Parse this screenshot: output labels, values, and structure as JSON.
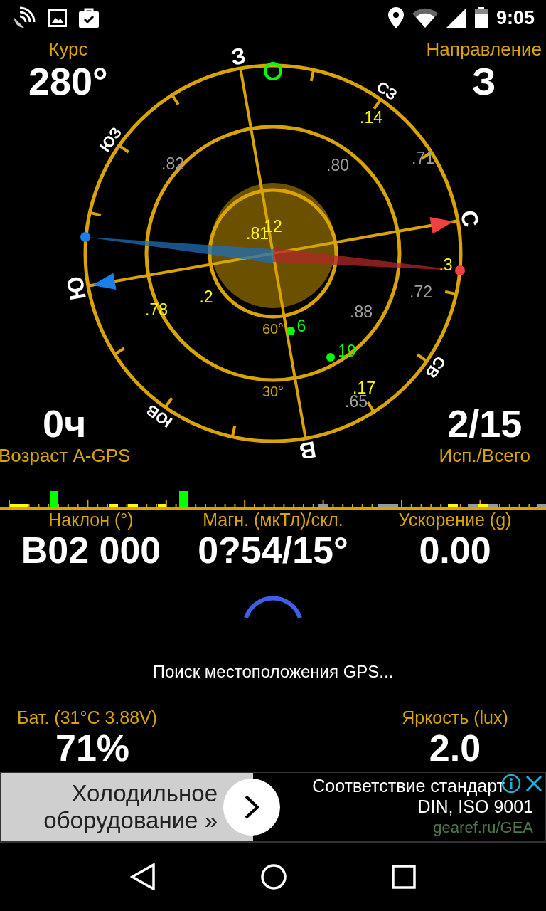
{
  "status_bar": {
    "time": "9:05"
  },
  "compass": {
    "course": {
      "label": "Курс",
      "value": "280°"
    },
    "direction": {
      "label": "Направление",
      "value": "З"
    },
    "agps": {
      "label": "Возраст A-GPS",
      "value": "0ч"
    },
    "used_total": {
      "label": "Исп./Всего",
      "value": "2/15"
    },
    "cardinals": [
      "С",
      "СВ",
      "В",
      "ЮВ",
      "Ю",
      "ЮЗ",
      "З",
      "СЗ"
    ],
    "rings": [
      "60°",
      "30°"
    ],
    "satellites": [
      {
        "label": ".14",
        "color": "#ffff00",
        "used": false
      },
      {
        "label": ".82",
        "color": "#a0a0a0",
        "used": false
      },
      {
        "label": ".80",
        "color": "#a0a0a0",
        "used": false
      },
      {
        "label": ".71",
        "color": "#a0a0a0",
        "used": false
      },
      {
        "label": ".81",
        "color": "#ffff00",
        "used": false
      },
      {
        "label": "12",
        "color": "#ffff00",
        "used": false
      },
      {
        "label": ".3",
        "color": "#ffff00",
        "used": false
      },
      {
        "label": ".72",
        "color": "#a0a0a0",
        "used": false
      },
      {
        "label": ".2",
        "color": "#ffff00",
        "used": false
      },
      {
        "label": ".78",
        "color": "#ffff00",
        "used": false
      },
      {
        "label": ".88",
        "color": "#a0a0a0",
        "used": false
      },
      {
        "label": "6",
        "color": "#00ff00",
        "used": true
      },
      {
        "label": "19",
        "color": "#00ff00",
        "used": true
      },
      {
        "label": ".17",
        "color": "#ffff00",
        "used": false
      },
      {
        "label": ".65",
        "color": "#a0a0a0",
        "used": false
      }
    ]
  },
  "readings": [
    {
      "label": "Наклон (°)",
      "value": "В02 000"
    },
    {
      "label": "Магн. (мкТл)/скл.",
      "value": "0?54/15°"
    },
    {
      "label": "Ускорение (g)",
      "value": "0.00"
    }
  ],
  "status": "Поиск местоположения GPS...",
  "battery": {
    "label": "Бат. (31°C 3.88V)",
    "value": "71%"
  },
  "brightness": {
    "label": "Яркость (lux)",
    "value": "2.0"
  },
  "ad": {
    "headline": "Холодильное оборудование »",
    "lines": [
      "Соответствие стандарт",
      "DIN, ISO 9001"
    ],
    "url": "gearef.ru/GEA"
  }
}
